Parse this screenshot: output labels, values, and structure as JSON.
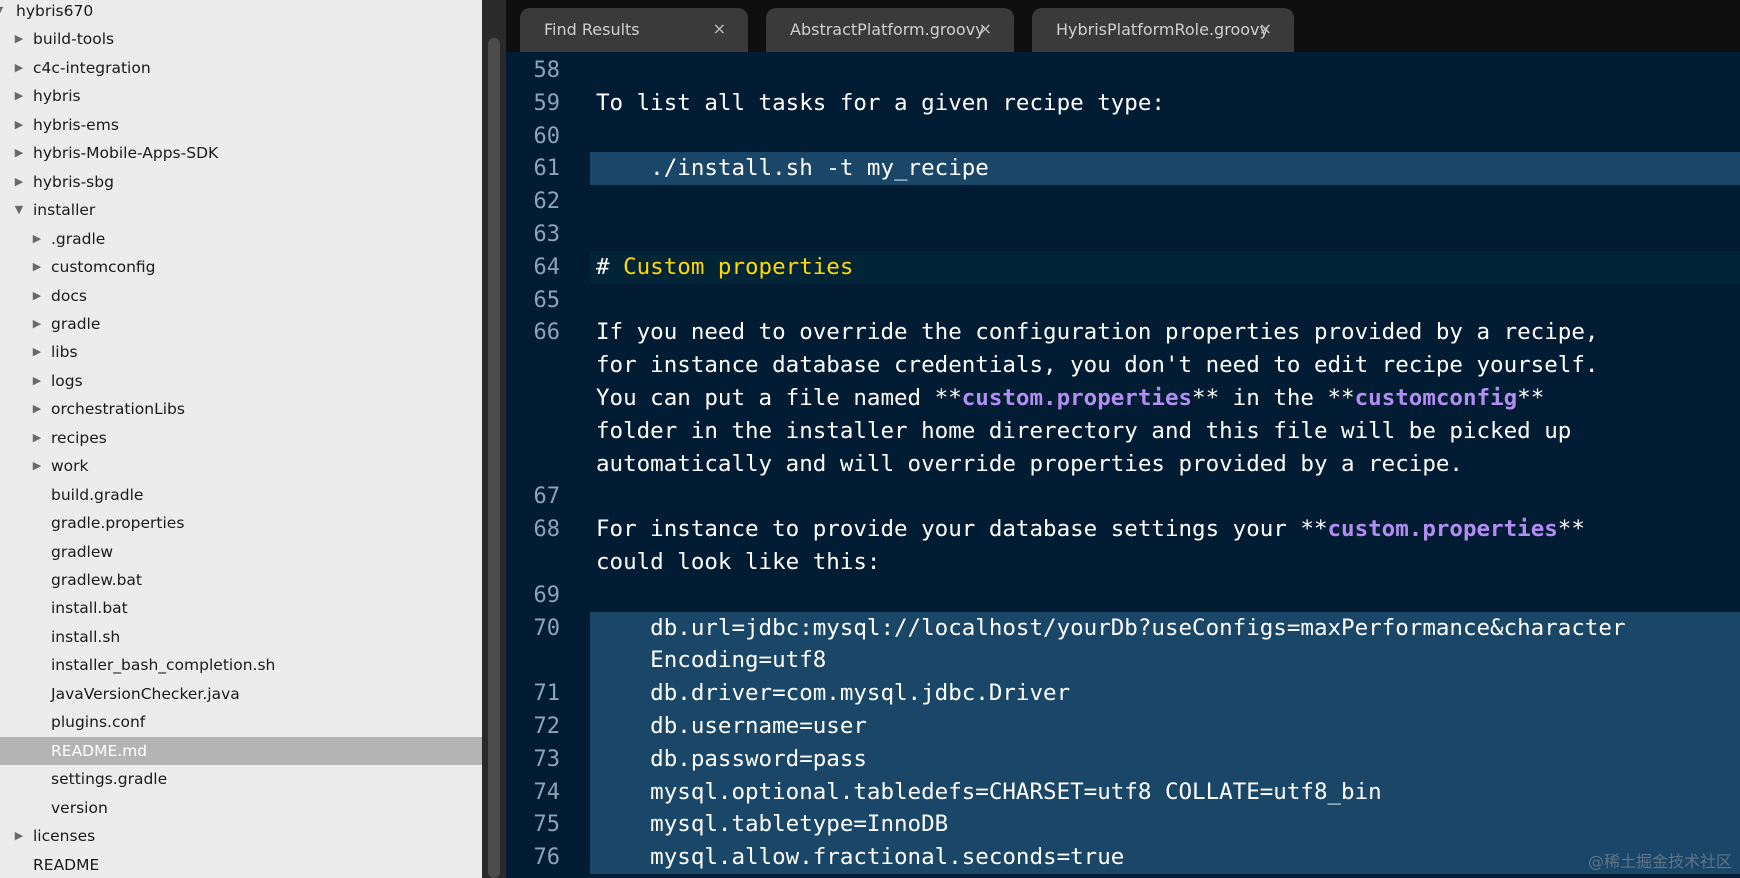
{
  "sidebar": {
    "rows": [
      {
        "label": "hybris670",
        "indent": 0,
        "arrow": "▼",
        "selected": false
      },
      {
        "label": "build-tools",
        "indent": 1,
        "arrow": "▶",
        "selected": false
      },
      {
        "label": "c4c-integration",
        "indent": 1,
        "arrow": "▶",
        "selected": false
      },
      {
        "label": "hybris",
        "indent": 1,
        "arrow": "▶",
        "selected": false
      },
      {
        "label": "hybris-ems",
        "indent": 1,
        "arrow": "▶",
        "selected": false
      },
      {
        "label": "hybris-Mobile-Apps-SDK",
        "indent": 1,
        "arrow": "▶",
        "selected": false
      },
      {
        "label": "hybris-sbg",
        "indent": 1,
        "arrow": "▶",
        "selected": false
      },
      {
        "label": "installer",
        "indent": 1,
        "arrow": "▼",
        "selected": false
      },
      {
        "label": ".gradle",
        "indent": 2,
        "arrow": "▶",
        "selected": false
      },
      {
        "label": "customconfig",
        "indent": 2,
        "arrow": "▶",
        "selected": false
      },
      {
        "label": "docs",
        "indent": 2,
        "arrow": "▶",
        "selected": false
      },
      {
        "label": "gradle",
        "indent": 2,
        "arrow": "▶",
        "selected": false
      },
      {
        "label": "libs",
        "indent": 2,
        "arrow": "▶",
        "selected": false
      },
      {
        "label": "logs",
        "indent": 2,
        "arrow": "▶",
        "selected": false
      },
      {
        "label": "orchestrationLibs",
        "indent": 2,
        "arrow": "▶",
        "selected": false
      },
      {
        "label": "recipes",
        "indent": 2,
        "arrow": "▶",
        "selected": false
      },
      {
        "label": "work",
        "indent": 2,
        "arrow": "▶",
        "selected": false
      },
      {
        "label": "build.gradle",
        "indent": 2,
        "arrow": "",
        "selected": false
      },
      {
        "label": "gradle.properties",
        "indent": 2,
        "arrow": "",
        "selected": false
      },
      {
        "label": "gradlew",
        "indent": 2,
        "arrow": "",
        "selected": false
      },
      {
        "label": "gradlew.bat",
        "indent": 2,
        "arrow": "",
        "selected": false
      },
      {
        "label": "install.bat",
        "indent": 2,
        "arrow": "",
        "selected": false
      },
      {
        "label": "install.sh",
        "indent": 2,
        "arrow": "",
        "selected": false
      },
      {
        "label": "installer_bash_completion.sh",
        "indent": 2,
        "arrow": "",
        "selected": false
      },
      {
        "label": "JavaVersionChecker.java",
        "indent": 2,
        "arrow": "",
        "selected": false
      },
      {
        "label": "plugins.conf",
        "indent": 2,
        "arrow": "",
        "selected": false
      },
      {
        "label": "README.md",
        "indent": 2,
        "arrow": "",
        "selected": true
      },
      {
        "label": "settings.gradle",
        "indent": 2,
        "arrow": "",
        "selected": false
      },
      {
        "label": "version",
        "indent": 2,
        "arrow": "",
        "selected": false
      },
      {
        "label": "licenses",
        "indent": 1,
        "arrow": "▶",
        "selected": false
      },
      {
        "label": "README",
        "indent": 1,
        "arrow": "",
        "selected": false
      }
    ]
  },
  "tabs": [
    {
      "label": "Find Results",
      "close": "×"
    },
    {
      "label": "AbstractPlatform.groovy",
      "close": "×"
    },
    {
      "label": "HybrisPlatformRole.groovy",
      "close": "×"
    }
  ],
  "editor": {
    "lines": [
      {
        "num": "58",
        "segments": [],
        "style": ""
      },
      {
        "num": "59",
        "segments": [
          {
            "t": "To list all tasks for a given recipe type:",
            "c": ""
          }
        ],
        "style": ""
      },
      {
        "num": "60",
        "segments": [],
        "style": ""
      },
      {
        "num": "61",
        "segments": [
          {
            "t": "    ./install.sh -t my_recipe",
            "c": ""
          }
        ],
        "style": "block"
      },
      {
        "num": "62",
        "segments": [],
        "style": ""
      },
      {
        "num": "63",
        "segments": [],
        "style": ""
      },
      {
        "num": "64",
        "segments": [
          {
            "t": "# ",
            "c": "heading-hash"
          },
          {
            "t": "Custom properties",
            "c": "heading-text"
          }
        ],
        "style": "active"
      },
      {
        "num": "65",
        "segments": [],
        "style": ""
      },
      {
        "num": "66",
        "segments": [
          {
            "t": "If you need to override the configuration properties provided by a recipe,",
            "c": ""
          }
        ],
        "style": ""
      },
      {
        "num": "",
        "segments": [
          {
            "t": "for instance database credentials, you don't need to edit recipe yourself.",
            "c": ""
          }
        ],
        "style": ""
      },
      {
        "num": "",
        "segments": [
          {
            "t": "You can put a file named **",
            "c": ""
          },
          {
            "t": "custom.properties",
            "c": "bold-text"
          },
          {
            "t": "** in the **",
            "c": ""
          },
          {
            "t": "customconfig",
            "c": "bold-text"
          },
          {
            "t": "**",
            "c": ""
          }
        ],
        "style": ""
      },
      {
        "num": "",
        "segments": [
          {
            "t": "folder in the installer home direrectory and this file will be picked up",
            "c": ""
          }
        ],
        "style": ""
      },
      {
        "num": "",
        "segments": [
          {
            "t": "automatically and will override properties provided by a recipe.",
            "c": ""
          }
        ],
        "style": ""
      },
      {
        "num": "67",
        "segments": [],
        "style": ""
      },
      {
        "num": "68",
        "segments": [
          {
            "t": "For instance to provide your database settings your **",
            "c": ""
          },
          {
            "t": "custom.properties",
            "c": "bold-text"
          },
          {
            "t": "**",
            "c": ""
          }
        ],
        "style": ""
      },
      {
        "num": "",
        "segments": [
          {
            "t": "could look like this:",
            "c": ""
          }
        ],
        "style": ""
      },
      {
        "num": "69",
        "segments": [],
        "style": ""
      },
      {
        "num": "70",
        "segments": [
          {
            "t": "    db.url=jdbc:mysql://localhost/yourDb?useConfigs=maxPerformance&character",
            "c": ""
          }
        ],
        "style": "block"
      },
      {
        "num": "",
        "segments": [
          {
            "t": "    Encoding=utf8",
            "c": ""
          }
        ],
        "style": "block"
      },
      {
        "num": "71",
        "segments": [
          {
            "t": "    db.driver=com.mysql.jdbc.Driver",
            "c": ""
          }
        ],
        "style": "block"
      },
      {
        "num": "72",
        "segments": [
          {
            "t": "    db.username=user",
            "c": ""
          }
        ],
        "style": "block"
      },
      {
        "num": "73",
        "segments": [
          {
            "t": "    db.password=pass",
            "c": ""
          }
        ],
        "style": "block"
      },
      {
        "num": "74",
        "segments": [
          {
            "t": "    mysql.optional.tabledefs=CHARSET=utf8 COLLATE=utf8_bin",
            "c": ""
          }
        ],
        "style": "block"
      },
      {
        "num": "75",
        "segments": [
          {
            "t": "    mysql.tabletype=InnoDB",
            "c": ""
          }
        ],
        "style": "block"
      },
      {
        "num": "76",
        "segments": [
          {
            "t": "    mysql.allow.fractional.seconds=true",
            "c": ""
          }
        ],
        "style": "block"
      }
    ]
  },
  "watermark": "@稀土掘金技术社区",
  "colors": {
    "editor_bg": "#021d33",
    "code_block_bg": "#1a4668",
    "heading": "#ffd800",
    "bold": "#b38df2",
    "line_number": "#8da4b8"
  }
}
